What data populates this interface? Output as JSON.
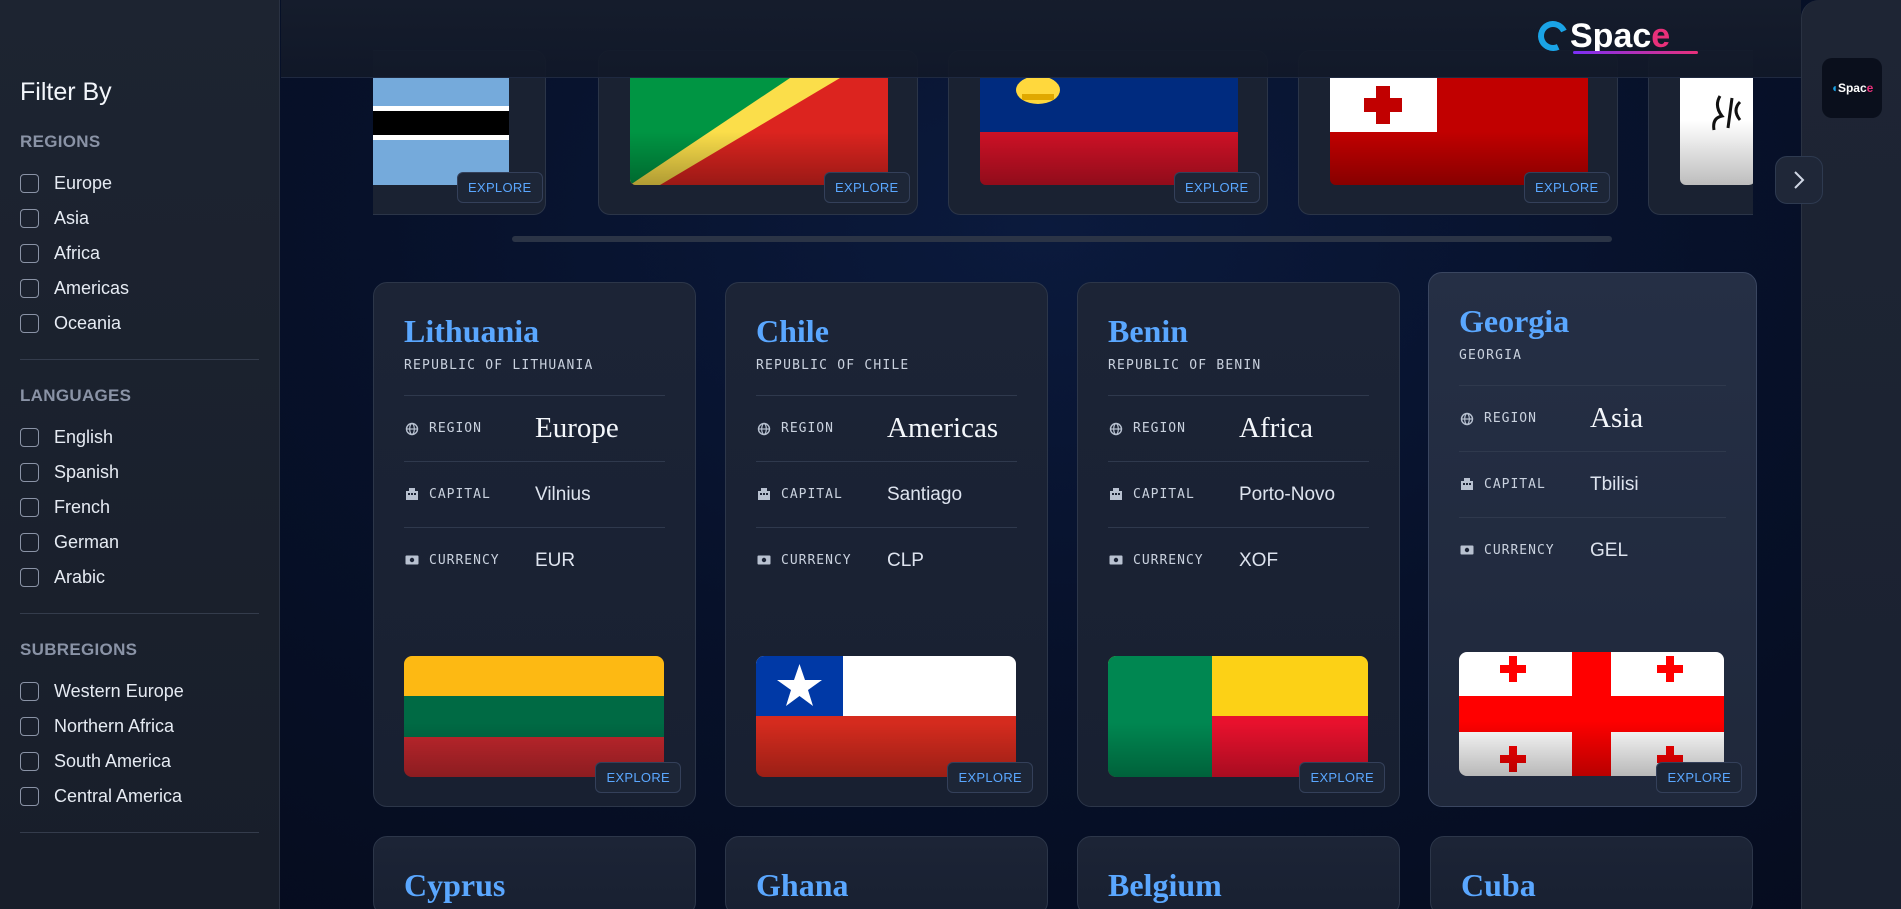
{
  "sidebar": {
    "title": "Filter By",
    "groups": [
      {
        "heading": "REGIONS",
        "options": [
          "Europe",
          "Asia",
          "Africa",
          "Americas",
          "Oceania"
        ]
      },
      {
        "heading": "LANGUAGES",
        "options": [
          "English",
          "Spanish",
          "French",
          "German",
          "Arabic"
        ]
      },
      {
        "heading": "SUBREGIONS",
        "options": [
          "Western Europe",
          "Northern Africa",
          "South America",
          "Central America"
        ]
      }
    ]
  },
  "header": {
    "logo_main": "Spac",
    "logo_accent": "e",
    "rail_logo_main": "Spac",
    "rail_logo_accent": "e"
  },
  "carousel": {
    "explore_label": "EXPLORE",
    "flags": [
      "botswana",
      "congo",
      "liechtenstein",
      "tonga",
      "afghanistan"
    ],
    "next_icon": "chevron-right-icon"
  },
  "cards": [
    {
      "name": "Lithuania",
      "official": "REPUBLIC OF LITHUANIA",
      "region": "Europe",
      "capital": "Vilnius",
      "currency": "EUR"
    },
    {
      "name": "Chile",
      "official": "REPUBLIC OF CHILE",
      "region": "Americas",
      "capital": "Santiago",
      "currency": "CLP"
    },
    {
      "name": "Benin",
      "official": "REPUBLIC OF BENIN",
      "region": "Africa",
      "capital": "Porto-Novo",
      "currency": "XOF"
    },
    {
      "name": "Georgia",
      "official": "GEORGIA",
      "region": "Asia",
      "capital": "Tbilisi",
      "currency": "GEL"
    }
  ],
  "labels": {
    "region": "REGION",
    "capital": "CAPITAL",
    "currency": "CURRENCY",
    "explore": "EXPLORE"
  },
  "next_row": [
    "Cyprus",
    "Ghana",
    "Belgium",
    "Cuba"
  ],
  "colors": {
    "accent_blue": "#5aa7ff",
    "brand_pink": "#e8307a",
    "brand_cyan": "#1aa3e6"
  }
}
